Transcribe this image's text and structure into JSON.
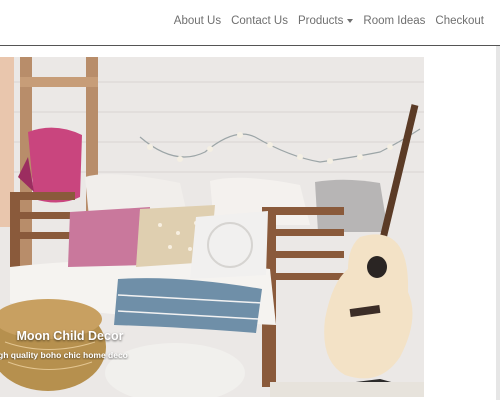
{
  "nav": {
    "items": [
      {
        "label": "About Us"
      },
      {
        "label": "Contact Us"
      },
      {
        "label": "Products"
      },
      {
        "label": "Room Ideas"
      },
      {
        "label": "Checkout"
      }
    ]
  },
  "hero": {
    "title": "Moon Child Decor",
    "subtitle": "gh quality boho chic home deco"
  },
  "colors": {
    "nav_text": "#6f6f6f",
    "divider": "#555555",
    "background": "#ffffff"
  }
}
